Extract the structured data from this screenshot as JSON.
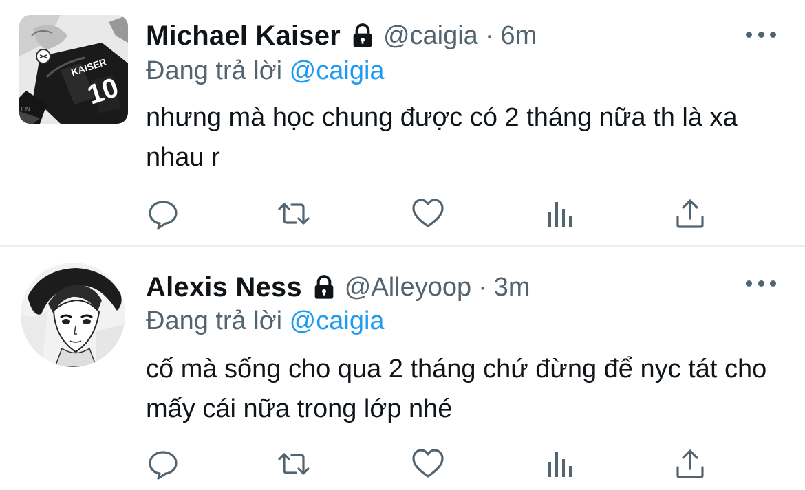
{
  "colors": {
    "text": "#0f1419",
    "secondary": "#536471",
    "accent": "#1d9bf0",
    "divider": "#eceff1"
  },
  "tweets": [
    {
      "display_name": "Michael Kaiser",
      "handle": "@caigia",
      "dot": "·",
      "time": "6m",
      "reply_prefix": "Đang trả lời",
      "reply_to": "@caigia",
      "text": "nhưng mà học chung được có 2 tháng nữa th là xa nhau r",
      "avatar_icon": "anime-avatar-kaiser",
      "avatar_text": "KAISER 10"
    },
    {
      "display_name": "Alexis Ness",
      "handle": "@Alleyoop",
      "dot": "·",
      "time": "3m",
      "reply_prefix": "Đang trả lời",
      "reply_to": "@caigia",
      "text": "cố mà sống cho qua 2 tháng chứ đừng để nyc tát cho mấy cái nữa trong lớp nhé",
      "avatar_icon": "anime-avatar-ness"
    }
  ],
  "icons": {
    "lock": "lock-icon",
    "more": "more-dots-icon",
    "reply": "reply-icon",
    "retweet": "retweet-icon",
    "like": "heart-icon",
    "views": "views-icon",
    "share": "share-icon"
  }
}
